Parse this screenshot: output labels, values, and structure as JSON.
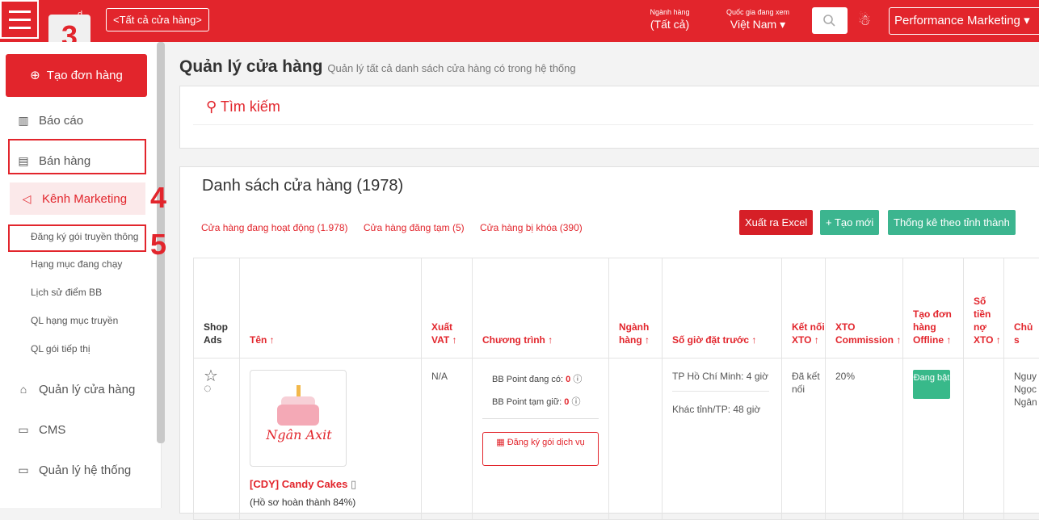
{
  "header": {
    "store_select": "<Tất cả cửa hàng>",
    "industry_label": "Ngành hàng",
    "industry_value": "(Tất cả)",
    "country_label": "Quốc gia đang xem",
    "country_value": "Việt Nam",
    "account_select": "Performance Marketing"
  },
  "steps": {
    "s3": "3",
    "s4": "4",
    "s5": "5"
  },
  "sidebar": {
    "create_order": "Tạo đơn hàng",
    "items": [
      {
        "label": "Báo cáo",
        "icon": "chart-icon"
      },
      {
        "label": "Bán hàng",
        "icon": "receipt-icon"
      },
      {
        "label": "Kênh Marketing",
        "icon": "megaphone-icon"
      },
      {
        "label": "Quản lý cửa hàng",
        "icon": "store-icon"
      },
      {
        "label": "CMS",
        "icon": "briefcase-icon"
      },
      {
        "label": "Quản lý hệ thống",
        "icon": "briefcase-icon"
      }
    ],
    "sub_items": [
      "Đăng ký gói truyền thông",
      "Hạng mục đang chạy",
      "Lịch sử điểm BB",
      "QL hạng mục truyền",
      "QL gói tiếp thị"
    ]
  },
  "main": {
    "title": "Quản lý cửa hàng",
    "subtitle": "Quản lý tất cả danh sách cửa hàng có trong hệ thống",
    "search_label": "Tìm kiếm",
    "list_title": "Danh sách cửa hàng (1978)",
    "filters": [
      "Cửa hàng đang hoạt động (1.978)",
      "Cửa hàng đăng tạm (5)",
      "Cửa hàng bị khóa (390)"
    ],
    "buttons": {
      "export": "Xuất ra Excel",
      "create": "+ Tạo mới",
      "stats": "Thống kê theo tỉnh thành"
    },
    "columns": [
      "Shop Ads",
      "Tên ↑",
      "Xuất VAT ↑",
      "Chương trình ↑",
      "Ngành hàng ↑",
      "Số giờ đặt trước ↑",
      "Kết nối XTO ↑",
      "XTO Commission ↑",
      "Tạo đơn hàng Offline ↑",
      "Số tiền nợ XTO ↑",
      "Chủ s"
    ],
    "row": {
      "logo_text": "Ngân Axit",
      "store_name": "[CDY] Candy Cakes",
      "store_sub": "(Hồ sơ hoàn thành 84%)",
      "vat": "N/A",
      "bb_available_label": "BB Point đang có:",
      "bb_available_value": "0",
      "bb_hold_label": "BB Point tạm giữ:",
      "bb_hold_value": "0",
      "register_btn": "Đăng ký gói dịch vụ",
      "industry": "",
      "hours_hcm": "TP Hồ Chí Minh: 4 giờ",
      "hours_other": "Khác tỉnh/TP: 48 giờ",
      "xto_connected": "Đã kết nối",
      "xto_commission": "20%",
      "offline_order": "Đang bật",
      "debt": "",
      "owner": "Nguy Ngọc Ngân"
    }
  }
}
